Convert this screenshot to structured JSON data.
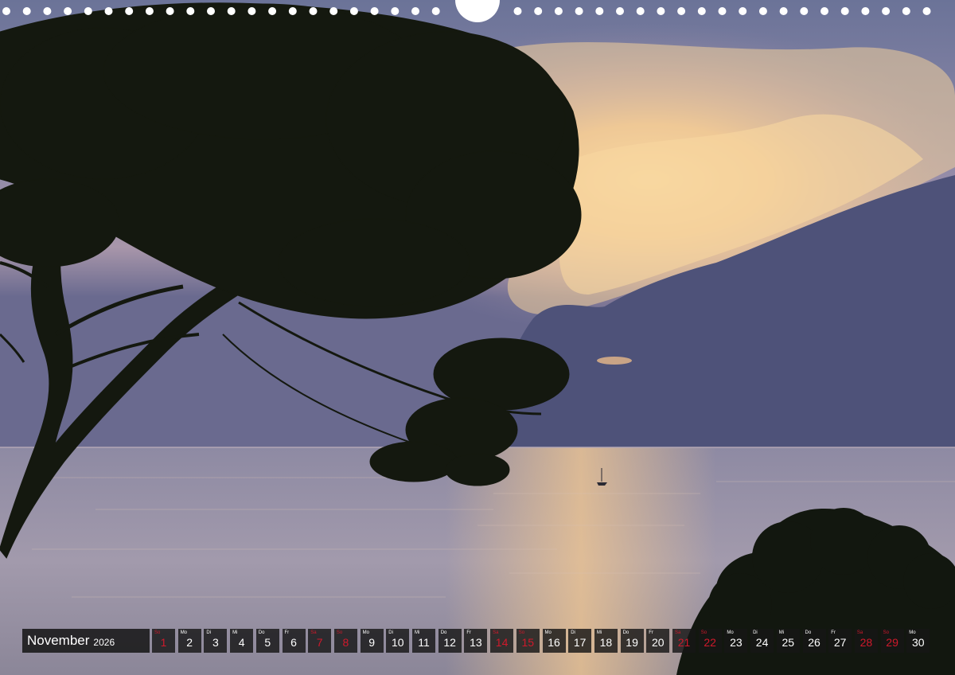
{
  "calendar": {
    "month": "November",
    "year": "2026",
    "days": [
      {
        "abbr": "So",
        "num": "1",
        "holiday": true
      },
      {
        "abbr": "Mo",
        "num": "2",
        "holiday": false
      },
      {
        "abbr": "Di",
        "num": "3",
        "holiday": false
      },
      {
        "abbr": "Mi",
        "num": "4",
        "holiday": false
      },
      {
        "abbr": "Do",
        "num": "5",
        "holiday": false
      },
      {
        "abbr": "Fr",
        "num": "6",
        "holiday": false
      },
      {
        "abbr": "Sa",
        "num": "7",
        "holiday": true
      },
      {
        "abbr": "So",
        "num": "8",
        "holiday": true
      },
      {
        "abbr": "Mo",
        "num": "9",
        "holiday": false
      },
      {
        "abbr": "Di",
        "num": "10",
        "holiday": false
      },
      {
        "abbr": "Mi",
        "num": "11",
        "holiday": false
      },
      {
        "abbr": "Do",
        "num": "12",
        "holiday": false
      },
      {
        "abbr": "Fr",
        "num": "13",
        "holiday": false
      },
      {
        "abbr": "Sa",
        "num": "14",
        "holiday": true
      },
      {
        "abbr": "So",
        "num": "15",
        "holiday": true
      },
      {
        "abbr": "Mo",
        "num": "16",
        "holiday": false
      },
      {
        "abbr": "Di",
        "num": "17",
        "holiday": false
      },
      {
        "abbr": "Mi",
        "num": "18",
        "holiday": false
      },
      {
        "abbr": "Do",
        "num": "19",
        "holiday": false
      },
      {
        "abbr": "Fr",
        "num": "20",
        "holiday": false
      },
      {
        "abbr": "Sa",
        "num": "21",
        "holiday": true
      },
      {
        "abbr": "So",
        "num": "22",
        "holiday": true
      },
      {
        "abbr": "Mo",
        "num": "23",
        "holiday": false
      },
      {
        "abbr": "Di",
        "num": "24",
        "holiday": false
      },
      {
        "abbr": "Mi",
        "num": "25",
        "holiday": false
      },
      {
        "abbr": "Do",
        "num": "26",
        "holiday": false
      },
      {
        "abbr": "Fr",
        "num": "27",
        "holiday": false
      },
      {
        "abbr": "Sa",
        "num": "28",
        "holiday": true
      },
      {
        "abbr": "So",
        "num": "29",
        "holiday": true
      },
      {
        "abbr": "Mo",
        "num": "30",
        "holiday": false
      }
    ]
  },
  "colors": {
    "holiday": "#d0192b",
    "cell_background": "#161616",
    "sky_glow": "#f7c98a",
    "cloud_bank": "#4a4f78",
    "sea": "#8d8aa0"
  }
}
